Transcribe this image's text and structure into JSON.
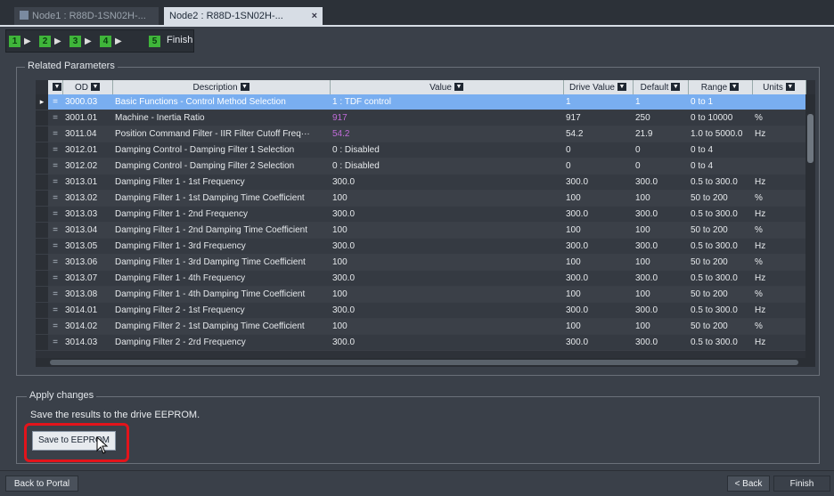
{
  "tabs": [
    {
      "label": "Node1 : R88D-1SN02H-..."
    },
    {
      "label": "Node2 : R88D-1SN02H-..."
    }
  ],
  "steps": {
    "numbers": [
      "1",
      "2",
      "3",
      "4",
      "5"
    ],
    "finish_label": "Finish"
  },
  "related": {
    "title": "Related Parameters",
    "columns": [
      "OD",
      "Description",
      "Value",
      "Drive Value",
      "Default",
      "Range",
      "Units"
    ],
    "rows": [
      {
        "od": "3000.03",
        "desc": "Basic Functions - Control Method Selection",
        "value": "1 : TDF control",
        "drive": "1",
        "default": "1",
        "range": "0 to 1",
        "units": ""
      },
      {
        "od": "3001.01",
        "desc": "Machine - Inertia Ratio",
        "value": "917",
        "drive": "917",
        "default": "250",
        "range": "0 to 10000",
        "units": "%"
      },
      {
        "od": "3011.04",
        "desc": "Position Command Filter - IIR Filter Cutoff Freq···",
        "value": "54.2",
        "drive": "54.2",
        "default": "21.9",
        "range": "1.0 to 5000.0",
        "units": "Hz"
      },
      {
        "od": "3012.01",
        "desc": "Damping Control - Damping Filter 1 Selection",
        "value": "0 : Disabled",
        "drive": "0",
        "default": "0",
        "range": "0 to 4",
        "units": ""
      },
      {
        "od": "3012.02",
        "desc": "Damping Control - Damping Filter 2 Selection",
        "value": "0 : Disabled",
        "drive": "0",
        "default": "0",
        "range": "0 to 4",
        "units": ""
      },
      {
        "od": "3013.01",
        "desc": "Damping Filter 1 - 1st Frequency",
        "value": "300.0",
        "drive": "300.0",
        "default": "300.0",
        "range": "0.5 to 300.0",
        "units": "Hz"
      },
      {
        "od": "3013.02",
        "desc": "Damping Filter 1 - 1st Damping Time Coefficient",
        "value": "100",
        "drive": "100",
        "default": "100",
        "range": "50 to 200",
        "units": "%"
      },
      {
        "od": "3013.03",
        "desc": "Damping Filter 1 - 2nd Frequency",
        "value": "300.0",
        "drive": "300.0",
        "default": "300.0",
        "range": "0.5 to 300.0",
        "units": "Hz"
      },
      {
        "od": "3013.04",
        "desc": "Damping Filter 1 - 2nd Damping Time Coefficient",
        "value": "100",
        "drive": "100",
        "default": "100",
        "range": "50 to 200",
        "units": "%"
      },
      {
        "od": "3013.05",
        "desc": "Damping Filter 1 - 3rd Frequency",
        "value": "300.0",
        "drive": "300.0",
        "default": "300.0",
        "range": "0.5 to 300.0",
        "units": "Hz"
      },
      {
        "od": "3013.06",
        "desc": "Damping Filter 1 - 3rd Damping Time Coefficient",
        "value": "100",
        "drive": "100",
        "default": "100",
        "range": "50 to 200",
        "units": "%"
      },
      {
        "od": "3013.07",
        "desc": "Damping Filter 1 - 4th Frequency",
        "value": "300.0",
        "drive": "300.0",
        "default": "300.0",
        "range": "0.5 to 300.0",
        "units": "Hz"
      },
      {
        "od": "3013.08",
        "desc": "Damping Filter 1 - 4th Damping Time Coefficient",
        "value": "100",
        "drive": "100",
        "default": "100",
        "range": "50 to 200",
        "units": "%"
      },
      {
        "od": "3014.01",
        "desc": "Damping Filter 2 - 1st Frequency",
        "value": "300.0",
        "drive": "300.0",
        "default": "300.0",
        "range": "0.5 to 300.0",
        "units": "Hz"
      },
      {
        "od": "3014.02",
        "desc": "Damping Filter 2 - 1st Damping Time Coefficient",
        "value": "100",
        "drive": "100",
        "default": "100",
        "range": "50 to 200",
        "units": "%"
      },
      {
        "od": "3014.03",
        "desc": "Damping Filter 2 - 2rd Frequency",
        "value": "300.0",
        "drive": "300.0",
        "default": "300.0",
        "range": "0.5 to 300.0",
        "units": "Hz"
      }
    ],
    "selected_row": 0,
    "purple_rows": [
      1,
      2
    ]
  },
  "apply": {
    "title": "Apply changes",
    "text": "Save the results to the drive EEPROM.",
    "save_label": "Save to EEPROM"
  },
  "footer": {
    "back_portal": "Back to Portal",
    "back": "< Back",
    "finish": "Finish"
  }
}
